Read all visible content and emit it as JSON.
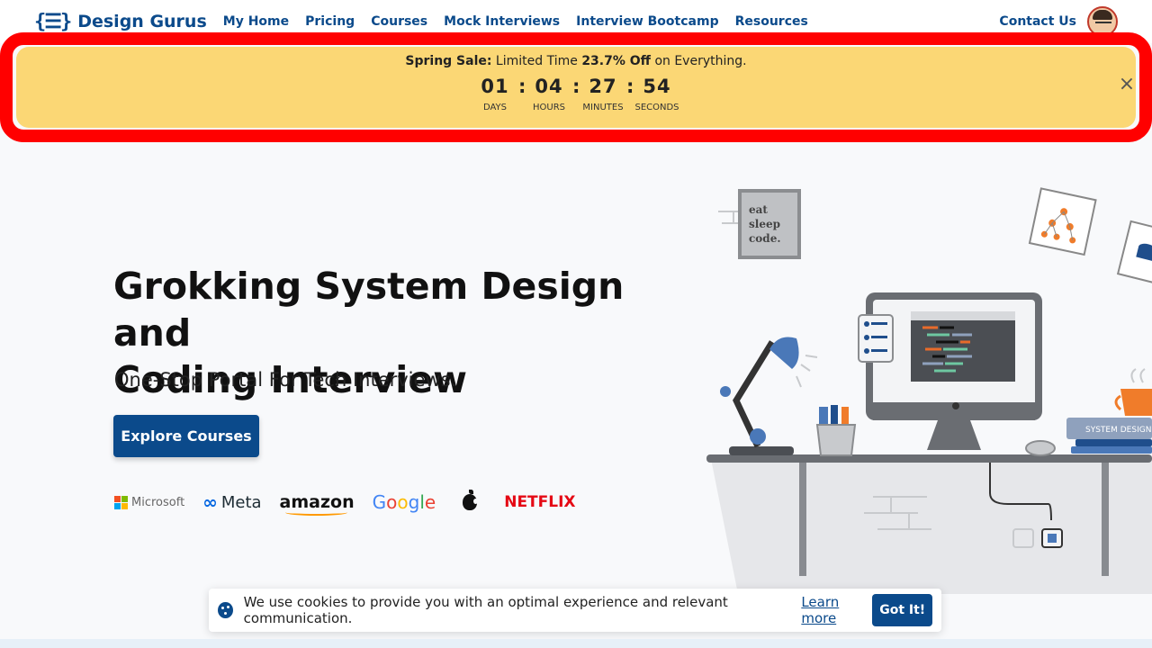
{
  "nav": {
    "logo_mark": "{☰}",
    "logo_text": "Design Gurus",
    "links": [
      "My Home",
      "Pricing",
      "Courses",
      "Mock Interviews",
      "Interview Bootcamp",
      "Resources"
    ],
    "contact": "Contact Us"
  },
  "banner": {
    "prefix": "Spring Sale:",
    "middle": " Limited Time ",
    "discount": "23.7% Off",
    "suffix": " on Everything.",
    "countdown": {
      "days": "01",
      "hours": "04",
      "minutes": "27",
      "seconds": "54",
      "days_label": "DAYS",
      "hours_label": "HOURS",
      "minutes_label": "MINUTES",
      "seconds_label": "SECONDS",
      "separator": ":"
    },
    "close_glyph": "×"
  },
  "hero": {
    "title_line1": "Grokking System Design and",
    "title_line2": "Coding Interview",
    "subtitle": "One-Stop Portal For Tech Interviews.",
    "cta": "Explore Courses"
  },
  "logos": {
    "microsoft": "Microsoft",
    "meta": "Meta",
    "meta_symbol": "∞",
    "amazon": "amazon",
    "google": [
      "G",
      "o",
      "o",
      "g",
      "l",
      "e"
    ],
    "netflix": "NETFLIX"
  },
  "illustration": {
    "poster_lines": [
      "eat",
      "sleep",
      "code."
    ],
    "book_label": "SYSTEM DESIGN"
  },
  "cookie": {
    "text": "We use cookies to provide you with an optimal experience and relevant communication.",
    "link": "Learn more",
    "button": "Got It!"
  },
  "colors": {
    "brand": "#0b4a8b",
    "banner_bg": "#fbd775",
    "highlight": "#ff0000",
    "google": [
      "#4285f4",
      "#ea4335",
      "#fbbc05",
      "#4285f4",
      "#34a853",
      "#ea4335"
    ]
  }
}
